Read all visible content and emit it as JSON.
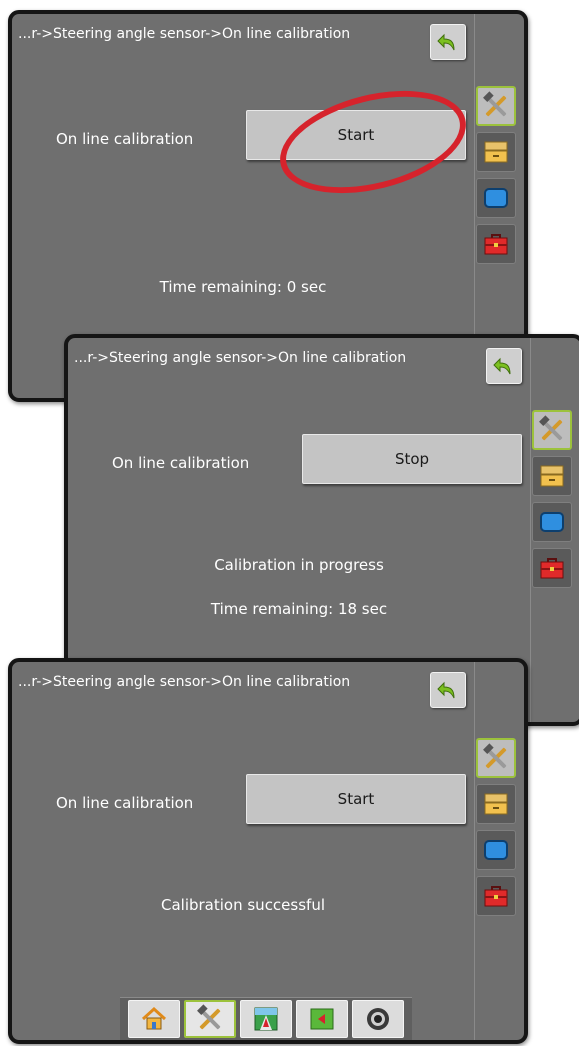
{
  "screens": [
    {
      "breadcrumb": "...r->Steering angle sensor->On line calibration",
      "row_label": "On line calibration",
      "button_label": "Start",
      "status_primary": "",
      "status_secondary": "Time remaining: 0 sec"
    },
    {
      "breadcrumb": "...r->Steering angle sensor->On line calibration",
      "row_label": "On line calibration",
      "button_label": "Stop",
      "status_primary": "Calibration in progress",
      "status_secondary": "Time remaining: 18 sec"
    },
    {
      "breadcrumb": "...r->Steering angle sensor->On line calibration",
      "row_label": "On line calibration",
      "button_label": "Start",
      "status_primary": "Calibration successful",
      "status_secondary": ""
    }
  ],
  "side_menu": {
    "icons": [
      "tools-icon",
      "drawer-icon",
      "display-icon",
      "toolbox-icon"
    ],
    "active_index": 0
  },
  "bottom_nav": {
    "icons": [
      "home-icon",
      "tools-icon",
      "field-view-icon",
      "guidance-icon",
      "camera-icon"
    ],
    "active_index": 1
  },
  "colors": {
    "screen_bg": "#6f6f6f",
    "bezel": "#151515",
    "accent_green": "#9cc23c",
    "callout_red": "#d6232c",
    "button_face": "#c4c4c4"
  }
}
